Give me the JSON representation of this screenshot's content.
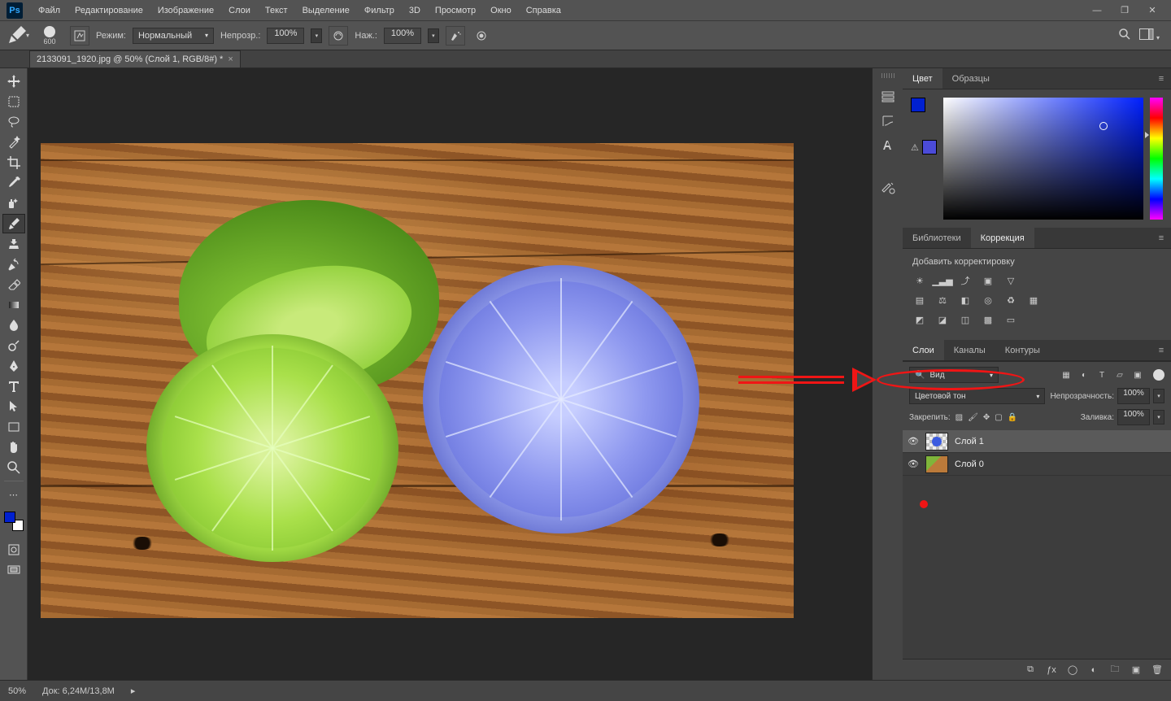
{
  "menubar": {
    "items": [
      "Файл",
      "Редактирование",
      "Изображение",
      "Слои",
      "Текст",
      "Выделение",
      "Фильтр",
      "3D",
      "Просмотр",
      "Окно",
      "Справка"
    ]
  },
  "optionsBar": {
    "brushSize": "600",
    "modeLabel": "Режим:",
    "modeValue": "Нормальный",
    "opacityLabel": "Непрозр.:",
    "opacityValue": "100%",
    "flowLabel": "Наж.:",
    "flowValue": "100%"
  },
  "docTab": {
    "title": "2133091_1920.jpg @ 50% (Слой 1, RGB/8#) *"
  },
  "colorPanel": {
    "tabs": [
      "Цвет",
      "Образцы"
    ],
    "fg": "#0020d0",
    "bg": "#4b4bd8"
  },
  "adjustPanel": {
    "tabs": [
      "Библиотеки",
      "Коррекция"
    ],
    "title": "Добавить корректировку"
  },
  "layersPanel": {
    "tabs": [
      "Слои",
      "Каналы",
      "Контуры"
    ],
    "filterLabel": "Вид",
    "blendMode": "Цветовой тон",
    "opacityLabel": "Непрозрачность:",
    "opacityValue": "100%",
    "lockLabel": "Закрепить:",
    "fillLabel": "Заливка:",
    "fillValue": "100%",
    "layers": [
      {
        "name": "Слой 1",
        "selected": true,
        "thumb": "checker"
      },
      {
        "name": "Слой 0",
        "selected": false,
        "thumb": "photo"
      }
    ]
  },
  "statusBar": {
    "zoom": "50%",
    "docInfo": "Док: 6,24M/13,8M"
  }
}
